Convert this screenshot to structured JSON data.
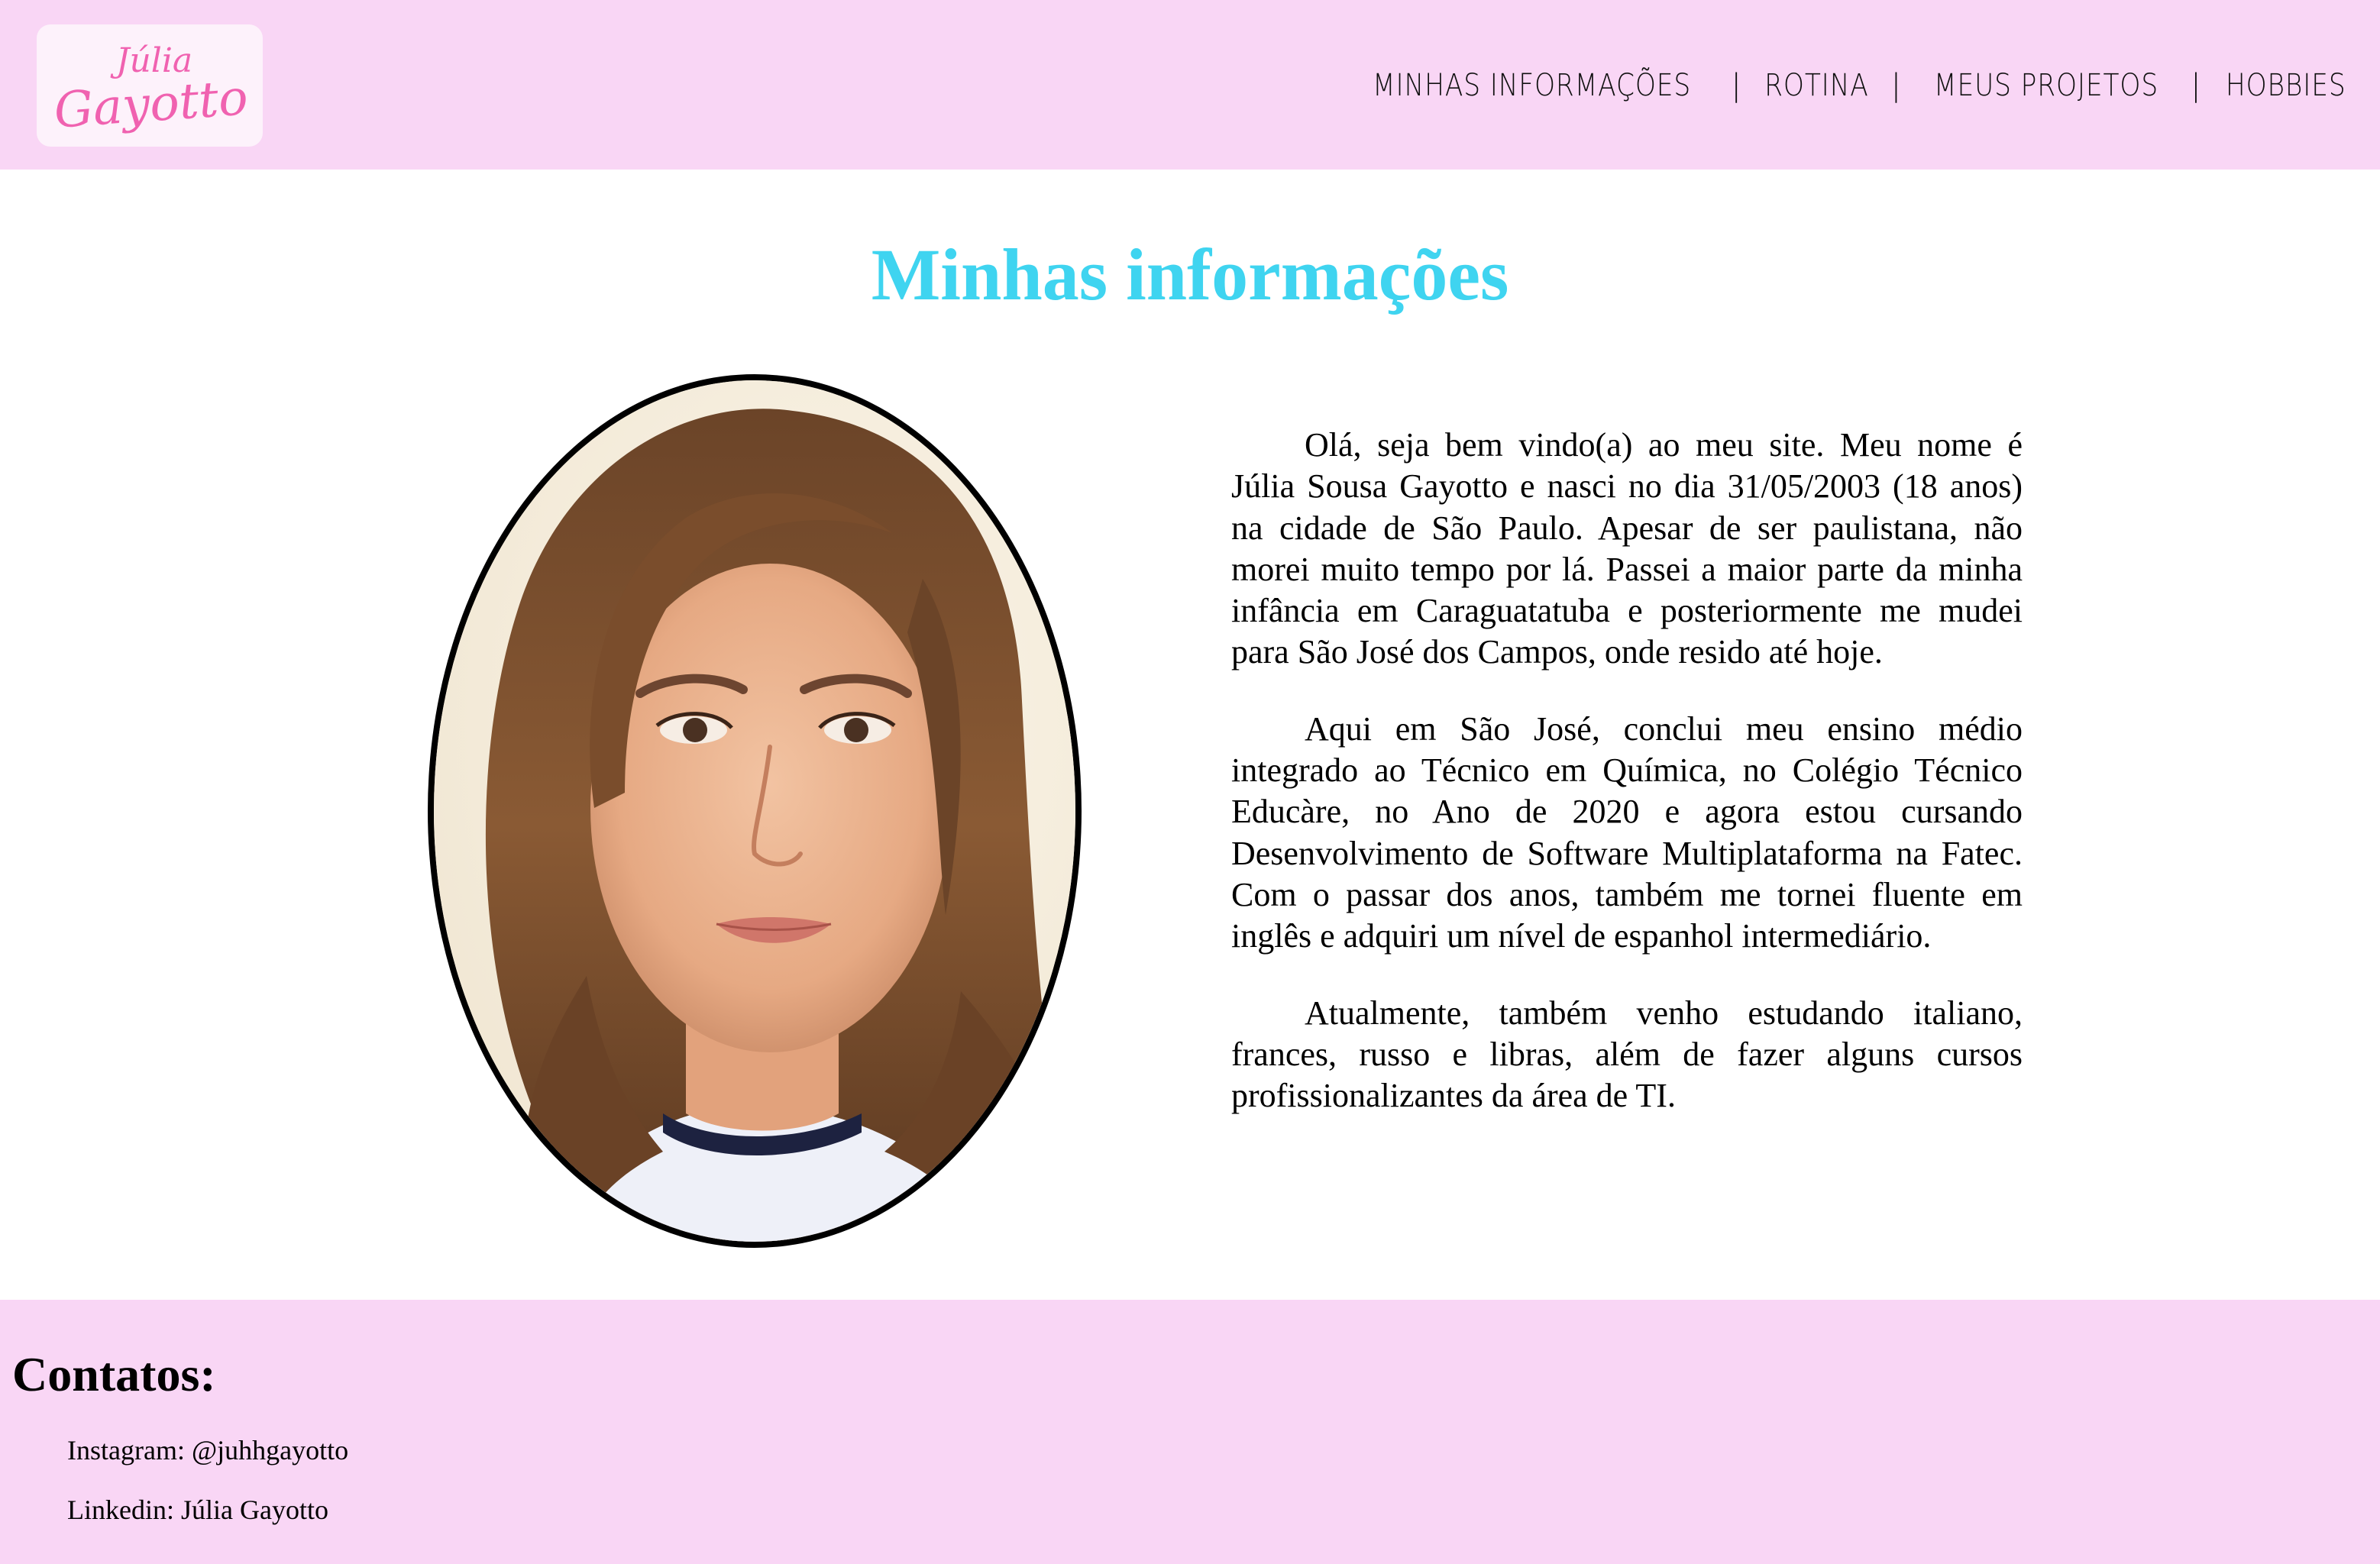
{
  "header": {
    "logo": {
      "line1": "Júlia",
      "line2": "Gayotto"
    },
    "nav": [
      {
        "label": "MINHAS INFORMAÇÕES"
      },
      {
        "label": "ROTINA"
      },
      {
        "label": "MEUS PROJETOS"
      },
      {
        "label": "HOBBIES"
      }
    ],
    "separator": "|"
  },
  "main": {
    "title": "Minhas informações",
    "photo": {
      "icon": "portrait-photo"
    },
    "paragraphs": [
      "Olá, seja bem vindo(a) ao meu site. Meu nome é Júlia Sousa Gayotto e nasci no dia 31/05/2003 (18 anos) na cidade de São Paulo. Apesar de ser paulistana, não morei muito tempo por lá. Passei a maior parte da minha infância em Caraguatatuba e posteriormente me mudei para São José dos Campos, onde resido até hoje.",
      "Aqui em São José, conclui meu ensino médio integrado ao Técnico em Química, no Colégio Técnico Educàre, no Ano de 2020 e agora estou cursando Desenvolvimento de Software Multiplataforma na Fatec. Com o passar dos anos, também me tornei fluente em inglês e adquiri um nível de espanhol intermediário.",
      "Atualmente, também venho estudando italiano, frances, russo e libras, além de fazer alguns cursos profissionalizantes da área de TI."
    ]
  },
  "footer": {
    "heading": "Contatos:",
    "contacts": [
      {
        "text": "Instagram: @juhhgayotto"
      },
      {
        "text": "Linkedin: Júlia Gayotto"
      }
    ]
  },
  "colors": {
    "header_bg": "#f9d6f5",
    "title": "#3fd4f0",
    "logo_text": "#f062b0"
  }
}
